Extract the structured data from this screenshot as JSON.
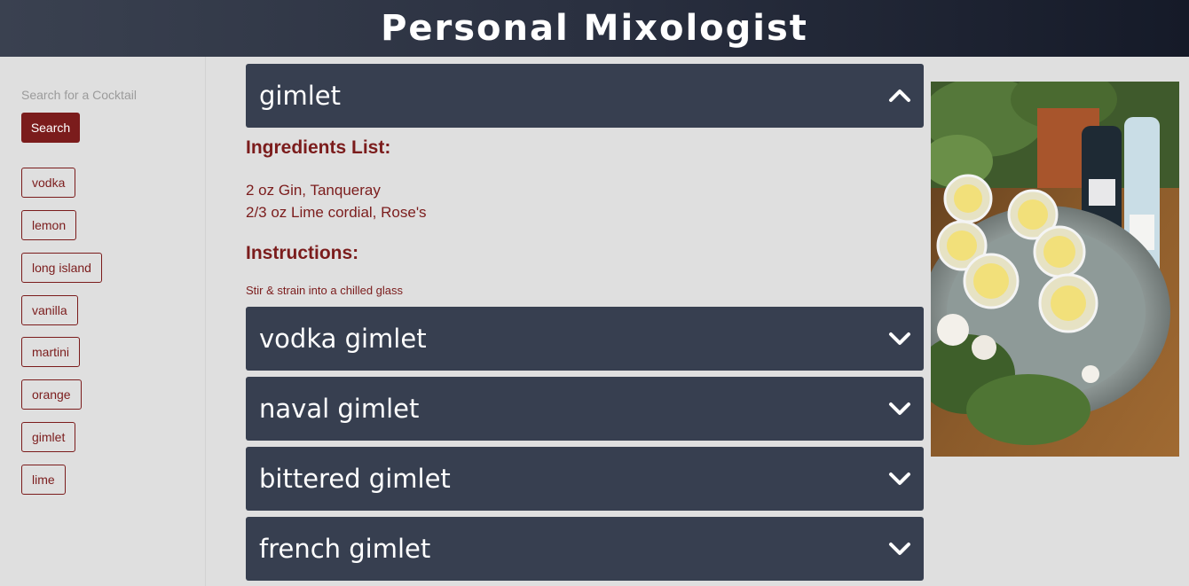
{
  "app": {
    "title": "Personal Mixologist"
  },
  "search": {
    "placeholder": "Search for a Cocktail",
    "value": "",
    "button_label": "Search"
  },
  "tags": [
    "vodka",
    "lemon",
    "long island",
    "vanilla",
    "martini",
    "orange",
    "gimlet",
    "lime"
  ],
  "expanded": {
    "title": "gimlet",
    "ingredients_heading": "Ingredients List:",
    "ingredients": [
      "2 oz Gin, Tanqueray",
      "2/3 oz Lime cordial, Rose's"
    ],
    "instructions_heading": "Instructions:",
    "instructions": "Stir & strain into a chilled glass"
  },
  "results": [
    "vodka gimlet",
    "naval gimlet",
    "bittered gimlet",
    "french gimlet"
  ],
  "icons": {
    "expanded": "chevron-up-icon",
    "collapsed": "chevron-down-icon"
  },
  "colors": {
    "accent": "#7b1c1c",
    "panel": "#373f50",
    "background": "#dfdfdf"
  }
}
